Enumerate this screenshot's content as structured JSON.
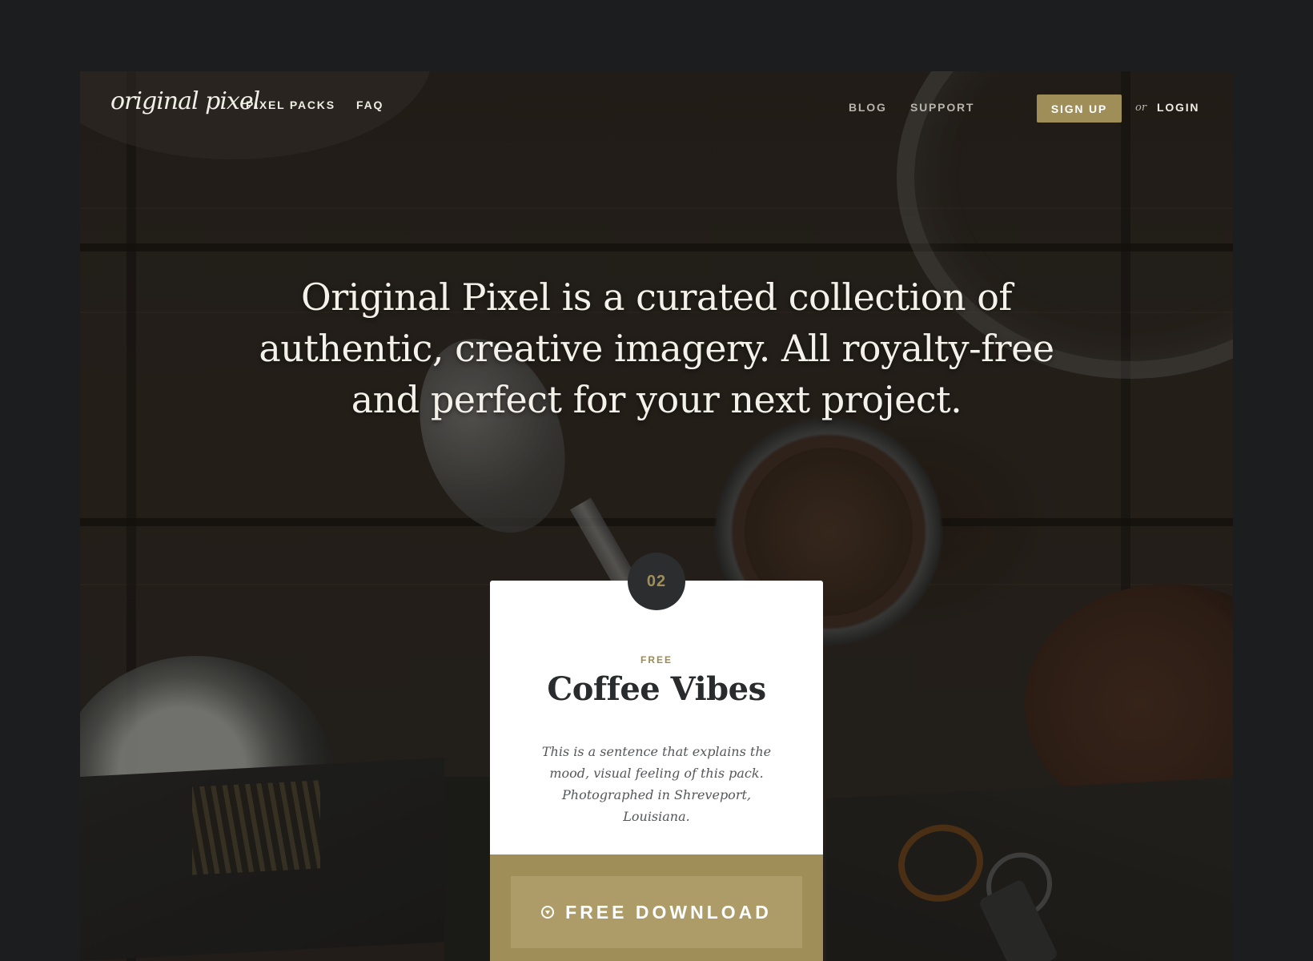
{
  "header": {
    "logo_text": "original pixel",
    "nav_left": [
      {
        "label": "PIXEL PACKS"
      },
      {
        "label": "FAQ"
      }
    ],
    "nav_right": [
      {
        "label": "BLOG"
      },
      {
        "label": "SUPPORT"
      }
    ],
    "signup_label": "SIGN UP",
    "or_text": "or",
    "login_label": "LOGIN"
  },
  "hero": {
    "lines": [
      "Original Pixel is a curated collection of",
      "authentic, creative imagery. All royalty-free",
      "and perfect for your next project."
    ]
  },
  "card": {
    "number": "02",
    "tag": "FREE",
    "title": "Coffee Vibes",
    "description": "This is a sentence that explains the mood, visual feeling of this pack. Photographed in Shreveport, Louisiana.",
    "download_label": "FREE DOWNLOAD",
    "download_icon": "download-circle-icon"
  },
  "colors": {
    "page_bg": "#1b1d1f",
    "accent_gold": "#a08e59",
    "badge_bg": "#2c2d2e"
  }
}
